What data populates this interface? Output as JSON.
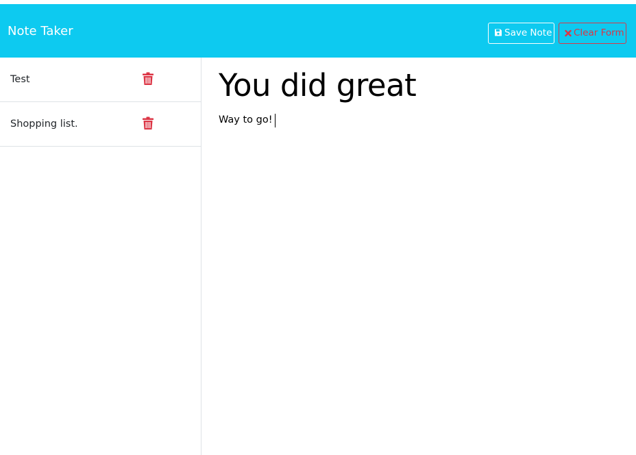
{
  "header": {
    "title": "Note Taker",
    "save_label": "Save Note",
    "clear_label": "Clear Form"
  },
  "notes": [
    {
      "title": "Test"
    },
    {
      "title": "Shopping list."
    }
  ],
  "editor": {
    "title_value": "You did great",
    "body_value": "Way to go!"
  },
  "colors": {
    "navbar": "#0dcaf0",
    "danger": "#dc3545",
    "white": "#ffffff"
  },
  "icons": {
    "save": "floppy-disk-icon",
    "clear": "x-icon",
    "delete": "trash-icon"
  }
}
